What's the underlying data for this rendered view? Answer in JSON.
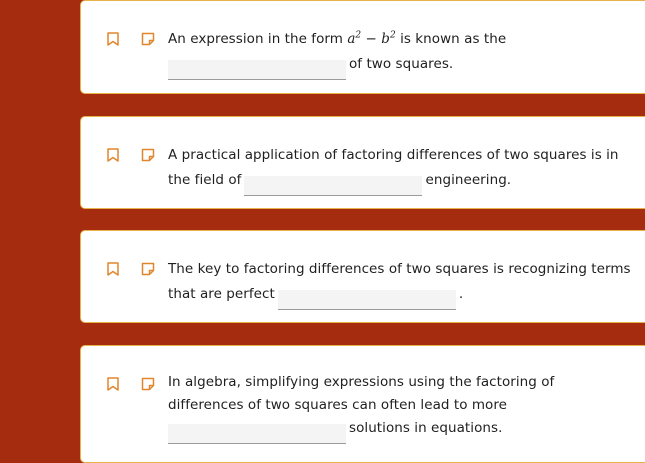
{
  "colors": {
    "page_background": "#a52c0e",
    "card_border": "#e8b24a",
    "icon_color": "#e0862c"
  },
  "icons": {
    "bookmark": "bookmark-icon",
    "note": "note-icon"
  },
  "questions": [
    {
      "before": "An expression in the form ",
      "math_a": "a",
      "math_a_exp": "2",
      "math_minus": " − ",
      "math_b": "b",
      "math_b_exp": "2",
      "after_math": " is known as the",
      "blank_value": "",
      "after": "of two squares."
    },
    {
      "before": "A practical application of factoring differences of two squares is in the field of",
      "blank_value": "",
      "after": "engineering."
    },
    {
      "before": "The key to factoring differences of two squares is recognizing terms that are perfect",
      "blank_value": "",
      "after": "."
    },
    {
      "before": "In algebra, simplifying expressions using the factoring of differences of two squares can often lead to more",
      "blank_value": "",
      "after": "solutions in equations."
    }
  ]
}
